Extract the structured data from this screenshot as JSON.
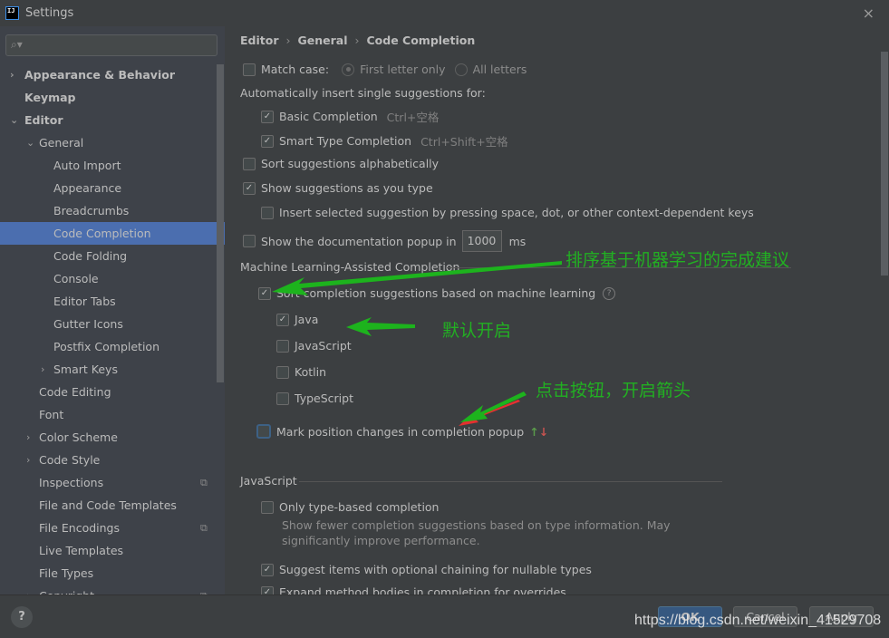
{
  "window": {
    "title": "Settings",
    "app_icon": "IJ",
    "close_icon": "×"
  },
  "sidebar": {
    "search_placeholder": "",
    "items": [
      {
        "label": "Appearance & Behavior",
        "level": 0,
        "bold": true,
        "arrow": "›"
      },
      {
        "label": "Keymap",
        "level": 0,
        "bold": true,
        "arrow": ""
      },
      {
        "label": "Editor",
        "level": 0,
        "bold": true,
        "arrow": "⌄"
      },
      {
        "label": "General",
        "level": 1,
        "arrow": "⌄"
      },
      {
        "label": "Auto Import",
        "level": 2
      },
      {
        "label": "Appearance",
        "level": 2
      },
      {
        "label": "Breadcrumbs",
        "level": 2
      },
      {
        "label": "Code Completion",
        "level": 2,
        "selected": true
      },
      {
        "label": "Code Folding",
        "level": 2
      },
      {
        "label": "Console",
        "level": 2
      },
      {
        "label": "Editor Tabs",
        "level": 2
      },
      {
        "label": "Gutter Icons",
        "level": 2
      },
      {
        "label": "Postfix Completion",
        "level": 2
      },
      {
        "label": "Smart Keys",
        "level": 2,
        "arrow": "›"
      },
      {
        "label": "Code Editing",
        "level": 1
      },
      {
        "label": "Font",
        "level": 1
      },
      {
        "label": "Color Scheme",
        "level": 1,
        "arrow": "›"
      },
      {
        "label": "Code Style",
        "level": 1,
        "arrow": "›"
      },
      {
        "label": "Inspections",
        "level": 1,
        "badge": "⧉"
      },
      {
        "label": "File and Code Templates",
        "level": 1
      },
      {
        "label": "File Encodings",
        "level": 1,
        "badge": "⧉"
      },
      {
        "label": "Live Templates",
        "level": 1
      },
      {
        "label": "File Types",
        "level": 1
      },
      {
        "label": "Copyright",
        "level": 1,
        "arrow": "›",
        "badge": "⧉"
      }
    ]
  },
  "breadcrumb": [
    "Editor",
    "General",
    "Code Completion"
  ],
  "settings": {
    "match_case": {
      "label": "Match case:",
      "checked": false
    },
    "match_case_options": [
      {
        "label": "First letter only",
        "selected": true
      },
      {
        "label": "All letters",
        "selected": false
      }
    ],
    "auto_insert_heading": "Automatically insert single suggestions for:",
    "basic_completion": {
      "label": "Basic Completion",
      "checked": true,
      "shortcut": "Ctrl+空格"
    },
    "smart_type_completion": {
      "label": "Smart Type Completion",
      "checked": true,
      "shortcut": "Ctrl+Shift+空格"
    },
    "sort_alpha": {
      "label": "Sort suggestions alphabetically",
      "checked": false
    },
    "show_as_type": {
      "label": "Show suggestions as you type",
      "checked": true
    },
    "insert_selected": {
      "label": "Insert selected suggestion by pressing space, dot, or other context-dependent keys",
      "checked": false
    },
    "doc_popup": {
      "label": "Show the documentation popup in",
      "checked": false,
      "value": "1000",
      "unit": "ms"
    },
    "ml_section": "Machine Learning-Assisted Completion",
    "ml_sort": {
      "label": "Sort completion suggestions based on machine learning",
      "checked": true
    },
    "ml_languages": [
      {
        "label": "Java",
        "checked": true
      },
      {
        "label": "JavaScript",
        "checked": false
      },
      {
        "label": "Kotlin",
        "checked": false
      },
      {
        "label": "TypeScript",
        "checked": false
      }
    ],
    "mark_position": {
      "label": "Mark position changes in completion popup",
      "checked": false,
      "up": "↑",
      "down": "↓"
    },
    "js_section": "JavaScript",
    "only_type_based": {
      "label": "Only type-based completion",
      "checked": false,
      "description_1": "Show fewer completion suggestions based on type information. May",
      "description_2": "significantly improve performance."
    },
    "optional_chaining": {
      "label": "Suggest items with optional chaining for nullable types",
      "checked": true
    },
    "expand_method": {
      "label": "Expand method bodies in completion for overrides",
      "checked": true
    }
  },
  "footer": {
    "help": "?",
    "ok": "OK",
    "cancel": "Cancel",
    "apply": "Apply"
  },
  "annotations": {
    "ml_note": "排序基于机器学习的完成建议",
    "default_note": "默认开启",
    "click_note": "点击按钮，开启箭头",
    "watermark": "https://blog.csdn.net/weixin_41529708"
  }
}
